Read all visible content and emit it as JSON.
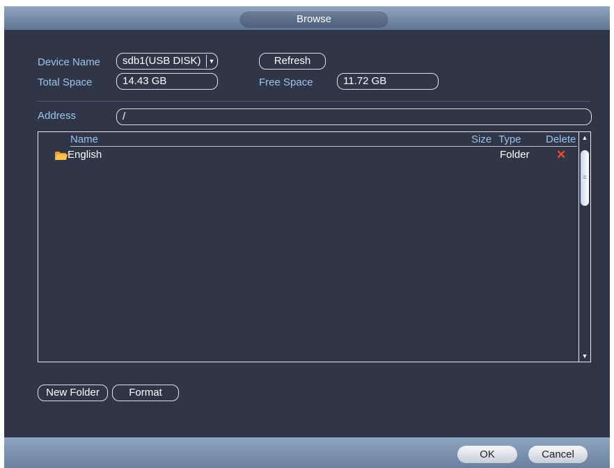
{
  "title": "Browse",
  "device_name": {
    "label": "Device Name",
    "value": "sdb1(USB DISK)"
  },
  "refresh_label": "Refresh",
  "total_space": {
    "label": "Total Space",
    "value": "14.43 GB"
  },
  "free_space": {
    "label": "Free Space",
    "value": "11.72 GB"
  },
  "address": {
    "label": "Address",
    "value": "/"
  },
  "columns": {
    "name": "Name",
    "size": "Size",
    "type": "Type",
    "delete": "Delete"
  },
  "rows": [
    {
      "name": "English",
      "size": "",
      "type": "Folder",
      "icon": "folder-icon",
      "delete_icon": "delete-x-icon"
    }
  ],
  "buttons": {
    "new_folder": "New Folder",
    "format": "Format",
    "ok": "OK",
    "cancel": "Cancel"
  },
  "colors": {
    "background": "#2e3647",
    "label": "#9ec4ea",
    "delete": "#ff4a1c",
    "bar": "#8fa6c2"
  }
}
